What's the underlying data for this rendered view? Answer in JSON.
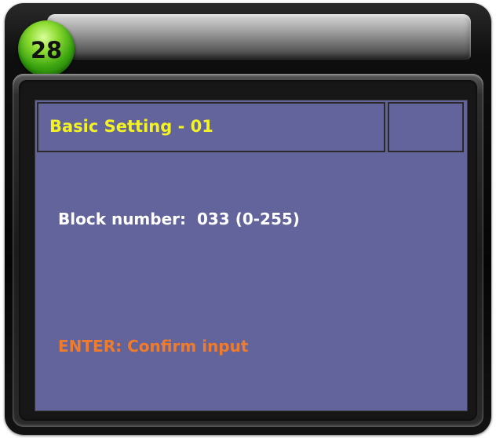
{
  "badge": {
    "number": "28"
  },
  "screen": {
    "title": "Basic Setting - 01",
    "field_label": "Block number:",
    "field_value": "033",
    "field_range": "(0-255)",
    "hint": "ENTER: Confirm input"
  },
  "colors": {
    "screen_background": "#63649c",
    "title_text": "#f2f224",
    "body_text": "#ffffff",
    "hint_text": "#f07b2a",
    "badge": "#3aa410"
  }
}
